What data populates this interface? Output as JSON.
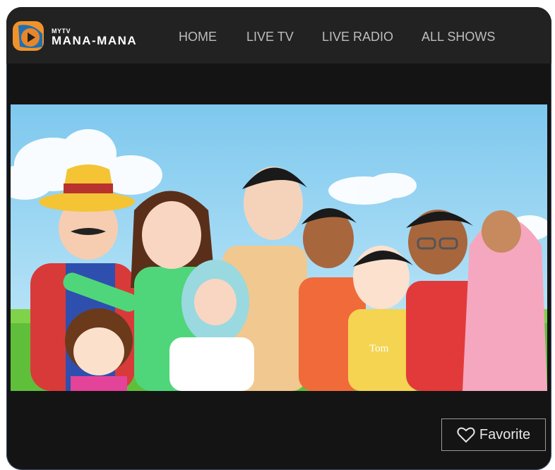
{
  "brand": {
    "small": "MYTV",
    "name": "MANA-MANA"
  },
  "nav": [
    {
      "label": "HOME"
    },
    {
      "label": "LIVE TV"
    },
    {
      "label": "LIVE RADIO"
    },
    {
      "label": "ALL SHOWS"
    }
  ],
  "player": {
    "shirt_text": "Tom"
  },
  "favorite": {
    "label": "Favorite"
  },
  "colors": {
    "page_bg": "#141414",
    "nav_bg": "#222222",
    "nav_text": "#bdbdbd",
    "logo_orange": "#f0932b",
    "logo_blue": "#1f6fb2"
  },
  "icons": {
    "favorite": "heart-outline-icon",
    "logo": "play-logo-icon"
  }
}
